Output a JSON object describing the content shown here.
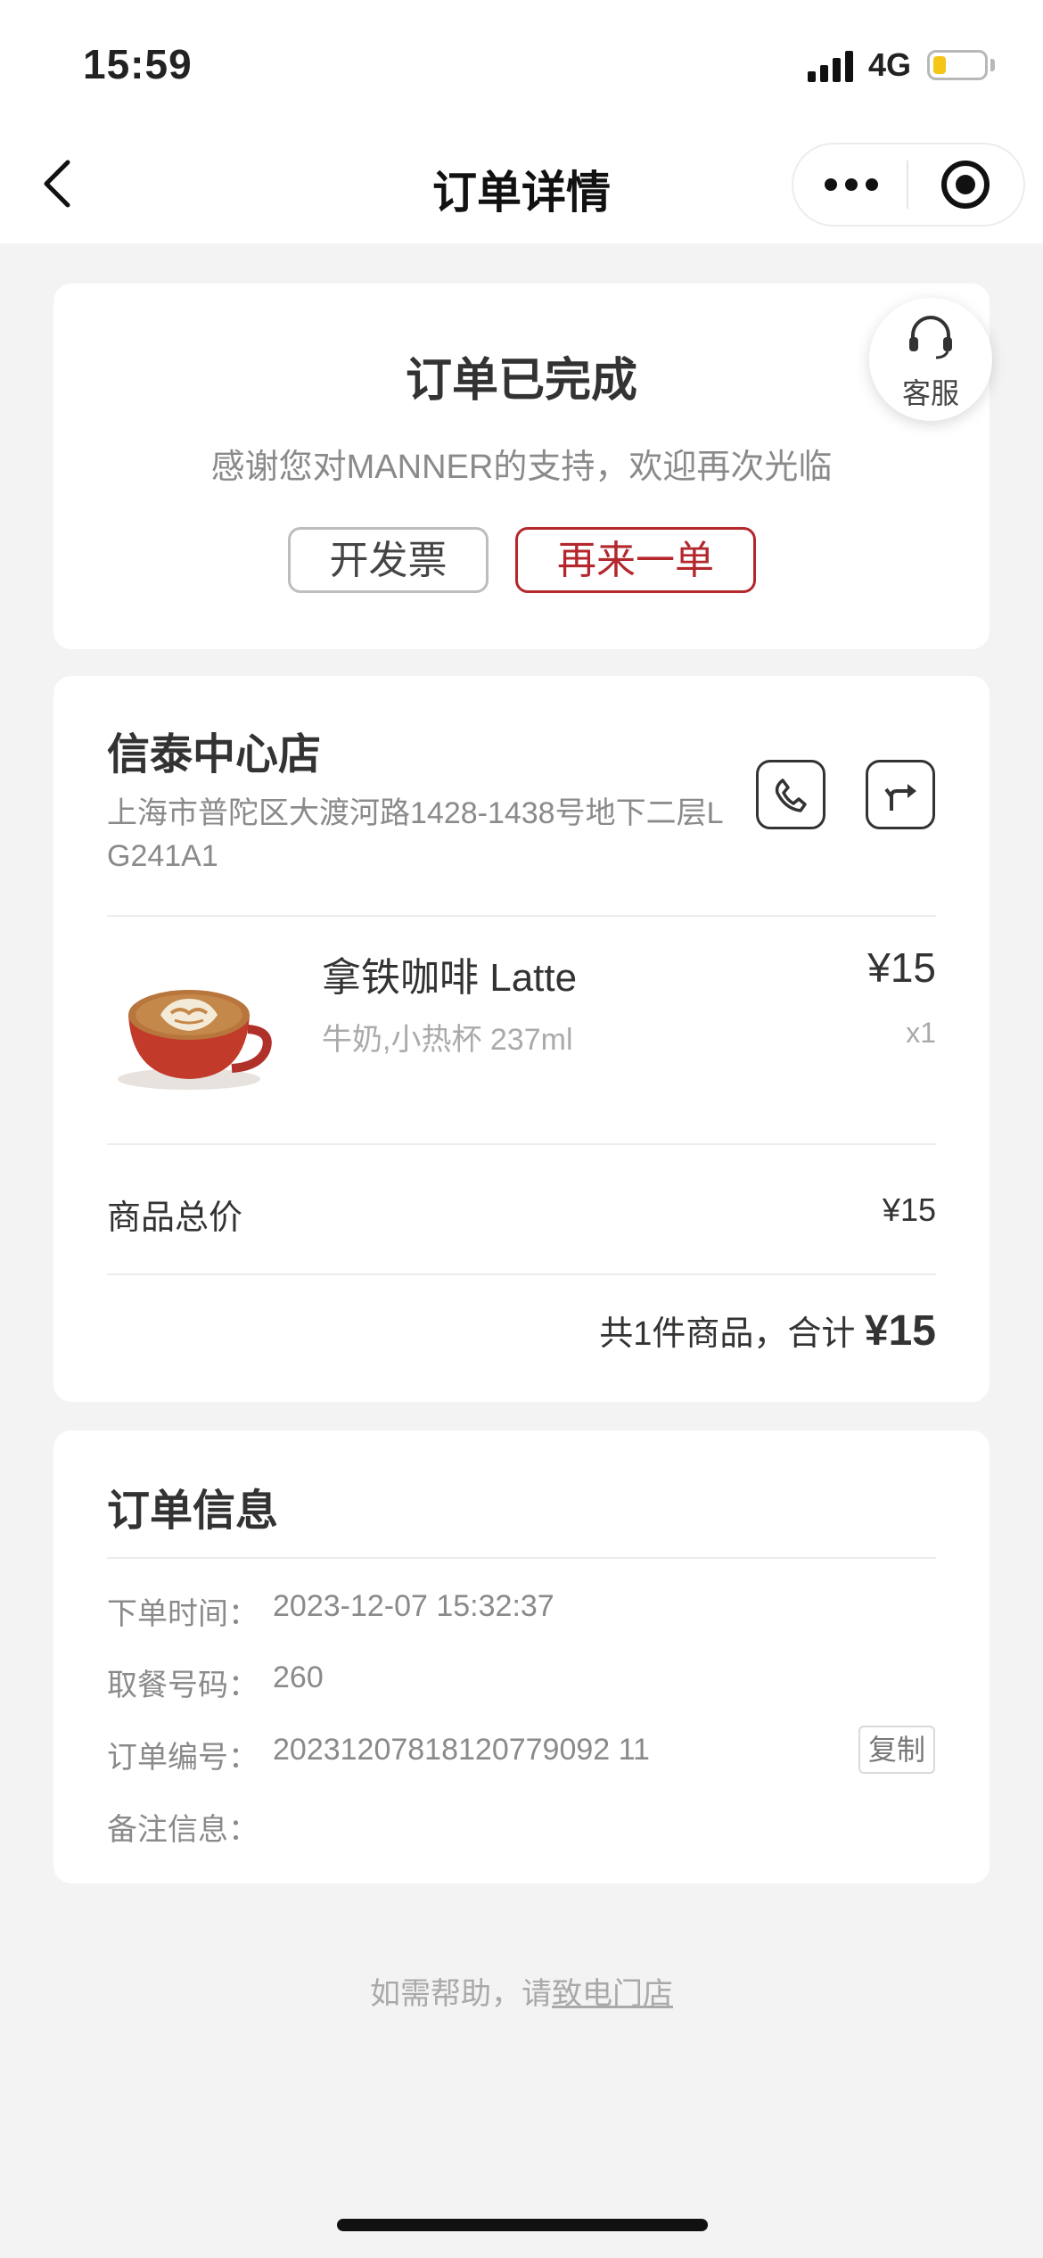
{
  "status_bar": {
    "time": "15:59",
    "network": "4G"
  },
  "nav": {
    "title": "订单详情"
  },
  "order_status": {
    "title": "订单已完成",
    "subtitle": "感谢您对MANNER的支持，欢迎再次光临",
    "invoice_button": "开发票",
    "reorder_button": "再来一单",
    "customer_service_label": "客服"
  },
  "store": {
    "name": "信泰中心店",
    "address": "上海市普陀区大渡河路1428-1438号地下二层LG241A1"
  },
  "product": {
    "name": "拿铁咖啡 Latte",
    "spec": "牛奶,小热杯 237ml",
    "price": "¥15",
    "quantity": "x1"
  },
  "summary": {
    "subtotal_label": "商品总价",
    "subtotal_value": "¥15",
    "total_text": "共1件商品，合计 ",
    "total_value": "¥15"
  },
  "order_info": {
    "title": "订单信息",
    "rows": [
      {
        "label": "下单时间：",
        "value": "2023-12-07 15:32:37"
      },
      {
        "label": "取餐号码：",
        "value": "260"
      },
      {
        "label": "订单编号：",
        "value": "20231207818120779092 11"
      },
      {
        "label": "备注信息：",
        "value": ""
      }
    ],
    "copy_button": "复制"
  },
  "footer": {
    "help_prefix": "如需帮助，请",
    "help_link": "致电门店"
  },
  "colors": {
    "accent": "#b3272d",
    "background": "#f3f3f3",
    "card": "#ffffff"
  }
}
